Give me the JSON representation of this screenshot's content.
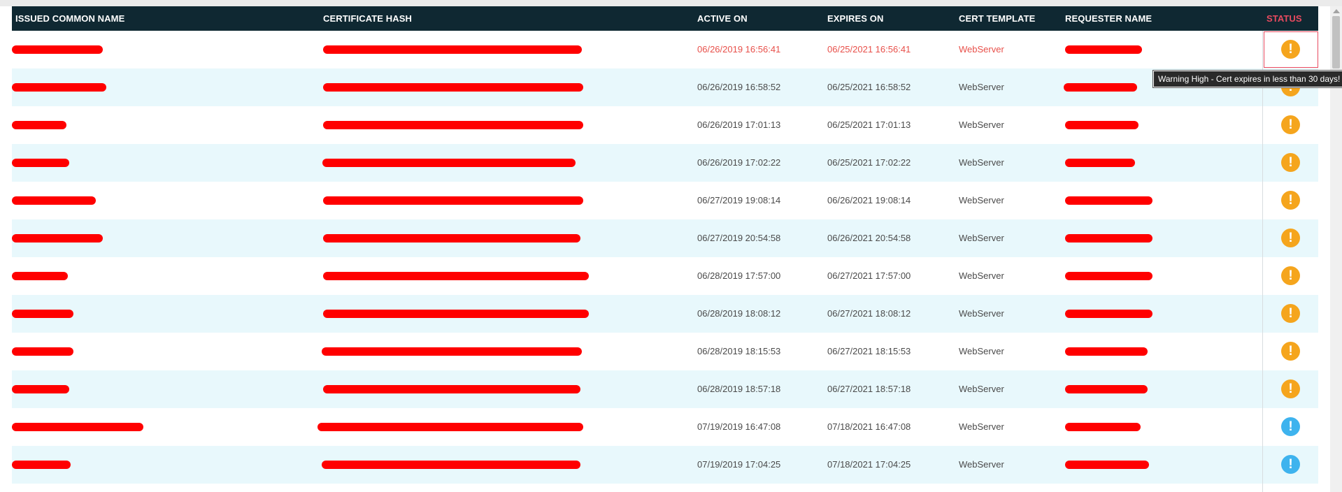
{
  "columns": {
    "common_name": "ISSUED COMMON NAME",
    "hash": "CERTIFICATE HASH",
    "active_on": "ACTIVE ON",
    "expires_on": "EXPIRES ON",
    "template": "CERT TEMPLATE",
    "requester": "REQUESTER NAME",
    "status": "STATUS"
  },
  "rows": [
    {
      "active_on": "06/26/2019 16:56:41",
      "expires_on": "06/25/2021 16:56:41",
      "template": "WebServer",
      "status": "warning-high",
      "status_icon": "exclamation-icon",
      "status_color": "#f5a51d",
      "highlighted": true
    },
    {
      "active_on": "06/26/2019 16:58:52",
      "expires_on": "06/25/2021 16:58:52",
      "template": "WebServer",
      "status": "warning-high",
      "status_icon": "exclamation-icon",
      "status_color": "#f5a51d",
      "highlighted": false
    },
    {
      "active_on": "06/26/2019 17:01:13",
      "expires_on": "06/25/2021 17:01:13",
      "template": "WebServer",
      "status": "warning-high",
      "status_icon": "exclamation-icon",
      "status_color": "#f5a51d",
      "highlighted": false
    },
    {
      "active_on": "06/26/2019 17:02:22",
      "expires_on": "06/25/2021 17:02:22",
      "template": "WebServer",
      "status": "warning-high",
      "status_icon": "exclamation-icon",
      "status_color": "#f5a51d",
      "highlighted": false
    },
    {
      "active_on": "06/27/2019 19:08:14",
      "expires_on": "06/26/2021 19:08:14",
      "template": "WebServer",
      "status": "warning-high",
      "status_icon": "exclamation-icon",
      "status_color": "#f5a51d",
      "highlighted": false
    },
    {
      "active_on": "06/27/2019 20:54:58",
      "expires_on": "06/26/2021 20:54:58",
      "template": "WebServer",
      "status": "warning-high",
      "status_icon": "exclamation-icon",
      "status_color": "#f5a51d",
      "highlighted": false
    },
    {
      "active_on": "06/28/2019 17:57:00",
      "expires_on": "06/27/2021 17:57:00",
      "template": "WebServer",
      "status": "warning-high",
      "status_icon": "exclamation-icon",
      "status_color": "#f5a51d",
      "highlighted": false
    },
    {
      "active_on": "06/28/2019 18:08:12",
      "expires_on": "06/27/2021 18:08:12",
      "template": "WebServer",
      "status": "warning-high",
      "status_icon": "exclamation-icon",
      "status_color": "#f5a51d",
      "highlighted": false
    },
    {
      "active_on": "06/28/2019 18:15:53",
      "expires_on": "06/27/2021 18:15:53",
      "template": "WebServer",
      "status": "warning-high",
      "status_icon": "exclamation-icon",
      "status_color": "#f5a51d",
      "highlighted": false
    },
    {
      "active_on": "06/28/2019 18:57:18",
      "expires_on": "06/27/2021 18:57:18",
      "template": "WebServer",
      "status": "warning-high",
      "status_icon": "exclamation-icon",
      "status_color": "#f5a51d",
      "highlighted": false
    },
    {
      "active_on": "07/19/2019 16:47:08",
      "expires_on": "07/18/2021 16:47:08",
      "template": "WebServer",
      "status": "info",
      "status_icon": "exclamation-icon",
      "status_color": "#3eb3ee",
      "highlighted": false
    },
    {
      "active_on": "07/19/2019 17:04:25",
      "expires_on": "07/18/2021 17:04:25",
      "template": "WebServer",
      "status": "info",
      "status_icon": "exclamation-icon",
      "status_color": "#3eb3ee",
      "highlighted": false
    }
  ],
  "status_glyph": "!",
  "tooltip": "Warning High - Cert expires in less than 30 days!",
  "colors": {
    "header_bg": "#0f2832",
    "status_header": "#e84a5f",
    "row_alt": "#e8f8fc",
    "highlight_text": "#e8504a",
    "warning": "#f5a51d",
    "info": "#3eb3ee",
    "redaction": "#ff0000"
  }
}
